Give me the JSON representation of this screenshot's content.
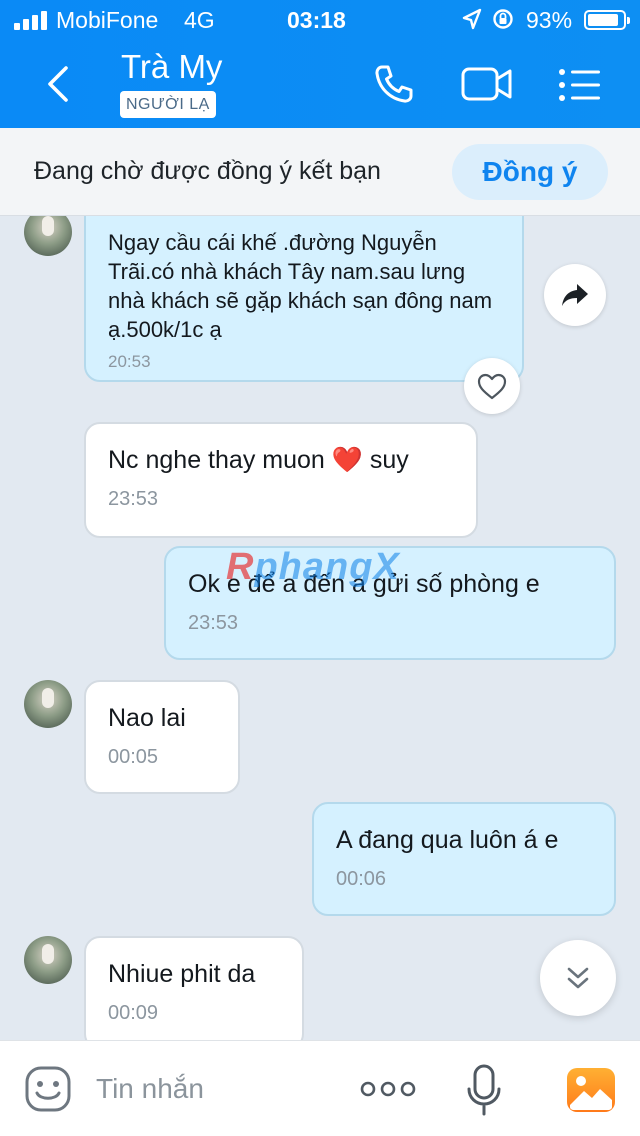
{
  "status_bar": {
    "carrier": "MobiFone",
    "network": "4G",
    "time": "03:18",
    "battery": "93%"
  },
  "header": {
    "contact_name": "Trà My",
    "badge": "NGƯỜI LẠ",
    "icons": [
      "back-icon",
      "phone-icon",
      "video-call-icon",
      "menu-icon"
    ],
    "accent_color": "#0a8af6"
  },
  "request": {
    "text": "Đang chờ được đồng ý kết bạn",
    "accept_label": "Đồng ý"
  },
  "messages": [
    {
      "direction": "in",
      "text": "Ngay cầu cái khế .đường Nguyễn Trãi.có nhà khách Tây nam.sau lưng nhà khách sẽ gặp khách sạn đông nam ạ.500k/1c ạ",
      "time": "20:53"
    },
    {
      "direction": "in",
      "text": "Nc nghe thay muon ❤️ suy",
      "time": "23:53"
    },
    {
      "direction": "out",
      "text": "Ok e để a đến a gửi số phòng e",
      "time": "23:53"
    },
    {
      "direction": "in",
      "text": "Nao lai",
      "time": "00:05"
    },
    {
      "direction": "out",
      "text": "A đang qua luôn á e",
      "time": "00:06"
    },
    {
      "direction": "in",
      "text": "Nhiue phit da",
      "time": "00:09"
    }
  ],
  "watermark": {
    "prefix": "R",
    "rest": "phangX"
  },
  "input_bar": {
    "placeholder": "Tin nhắn",
    "icons": [
      "emoji-icon",
      "more-icon",
      "microphone-icon",
      "image-icon"
    ]
  }
}
